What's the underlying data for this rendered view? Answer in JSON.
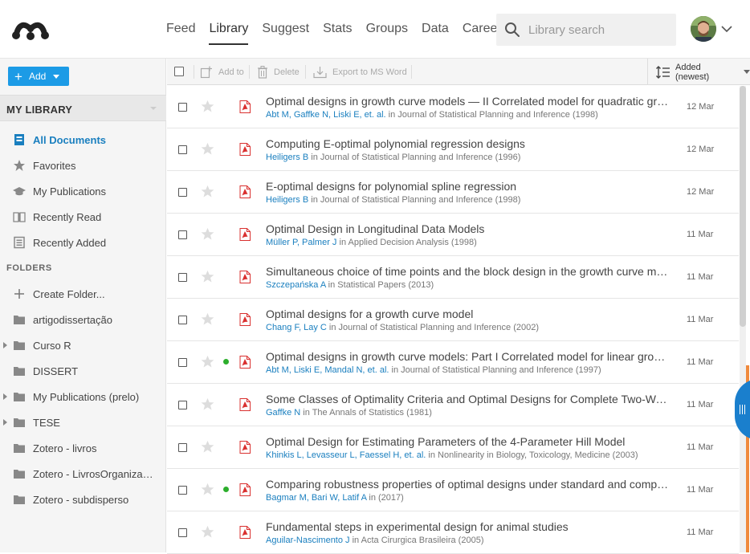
{
  "nav": {
    "items": [
      {
        "label": "Feed",
        "active": false
      },
      {
        "label": "Library",
        "active": true
      },
      {
        "label": "Suggest",
        "active": false
      },
      {
        "label": "Stats",
        "active": false
      },
      {
        "label": "Groups",
        "active": false
      },
      {
        "label": "Data",
        "active": false
      },
      {
        "label": "Careers",
        "active": false
      }
    ],
    "search_placeholder": "Library search"
  },
  "sidebar": {
    "add_label": "Add",
    "section_title": "MY LIBRARY",
    "items": [
      {
        "label": "All Documents",
        "icon": "document-icon",
        "active": true
      },
      {
        "label": "Favorites",
        "icon": "star-icon"
      },
      {
        "label": "My Publications",
        "icon": "graduation-cap-icon"
      },
      {
        "label": "Recently Read",
        "icon": "open-book-icon"
      },
      {
        "label": "Recently Added",
        "icon": "calendar-icon"
      }
    ],
    "folders_label": "FOLDERS",
    "folders": [
      {
        "label": "Create Folder...",
        "icon": "plus-icon",
        "expandable": false
      },
      {
        "label": "artigodissertação",
        "icon": "folder-icon",
        "expandable": false
      },
      {
        "label": "Curso R",
        "icon": "folder-icon",
        "expandable": true
      },
      {
        "label": "DISSERT",
        "icon": "folder-icon",
        "expandable": false
      },
      {
        "label": "My Publications (prelo)",
        "icon": "folder-icon",
        "expandable": true
      },
      {
        "label": "TESE",
        "icon": "folder-icon",
        "expandable": true
      },
      {
        "label": "Zotero - livros",
        "icon": "folder-icon",
        "expandable": false
      },
      {
        "label": "Zotero - LivrosOrganizados",
        "icon": "folder-icon",
        "expandable": false
      },
      {
        "label": "Zotero - subdisperso",
        "icon": "folder-icon",
        "expandable": false
      }
    ]
  },
  "toolbar": {
    "add_to": "Add to",
    "delete": "Delete",
    "export": "Export to MS Word",
    "sort": "Added (newest)"
  },
  "documents": [
    {
      "title": "Optimal designs in growth curve models — II Correlated model for quadratic growth: optimal designs for slope parameter",
      "authors": "Abt M, Gaffke N, Liski E, et. al.",
      "journal": "Journal of Statistical Planning and Inference",
      "year": "1998",
      "date": "12 Mar",
      "unread": false
    },
    {
      "title": "Computing E-optimal polynomial regression designs",
      "authors": "Heiligers B",
      "journal": "Journal of Statistical Planning and Inference",
      "year": "1996",
      "date": "12 Mar",
      "unread": false
    },
    {
      "title": "E-optimal designs for polynomial spline regression",
      "authors": "Heiligers B",
      "journal": "Journal of Statistical Planning and Inference",
      "year": "1998",
      "date": "12 Mar",
      "unread": false
    },
    {
      "title": "Optimal Design in Longitudinal Data Models",
      "authors": "Müller P, Palmer J",
      "journal": "Applied Decision Analysis",
      "year": "1998",
      "date": "11 Mar",
      "unread": false
    },
    {
      "title": "Simultaneous choice of time points and the block design in the growth curve model",
      "authors": "Szczepańska A",
      "journal": "Statistical Papers",
      "year": "2013",
      "date": "11 Mar",
      "unread": false
    },
    {
      "title": "Optimal designs for a growth curve model",
      "authors": "Chang F, Lay C",
      "journal": "Journal of Statistical Planning and Inference",
      "year": "2002",
      "date": "11 Mar",
      "unread": false
    },
    {
      "title": "Optimal designs in growth curve models: Part I Correlated model for linear growth: optimal designs for slope parameter",
      "authors": "Abt M, Liski E, Mandal N, et. al.",
      "journal": "Journal of Statistical Planning and Inference",
      "year": "1997",
      "date": "11 Mar",
      "unread": true
    },
    {
      "title": "Some Classes of Optimality Criteria and Optimal Designs for Complete Two-Way Layouts",
      "authors": "Gaffke N",
      "journal": "The Annals of Statistics",
      "year": "1981",
      "date": "11 Mar",
      "unread": false
    },
    {
      "title": "Optimal Design for Estimating Parameters of the 4-Parameter Hill Model",
      "authors": "Khinkis L, Levasseur L, Faessel H, et. al.",
      "journal": "Nonlinearity in Biology, Toxicology, Medicine",
      "year": "2003",
      "date": "11 Mar",
      "unread": false
    },
    {
      "title": "Comparing robustness properties of optimal designs under standard and compound criteria",
      "authors": "Bagmar M, Bari W, Latif A",
      "journal": "",
      "year": "2017",
      "date": "11 Mar",
      "unread": true
    },
    {
      "title": "Fundamental steps in experimental design for animal studies",
      "authors": "Aguilar-Nascimento J",
      "journal": "Acta Cirurgica Brasileira",
      "year": "2005",
      "date": "11 Mar",
      "unread": false
    }
  ],
  "colors": {
    "accent": "#1c9be6",
    "link": "#1a7fbf",
    "unread_dot": "#2cae2c",
    "pdf_red": "#d9302f",
    "handle": "#1a7fcd",
    "progress_orange": "#f08a3c"
  }
}
